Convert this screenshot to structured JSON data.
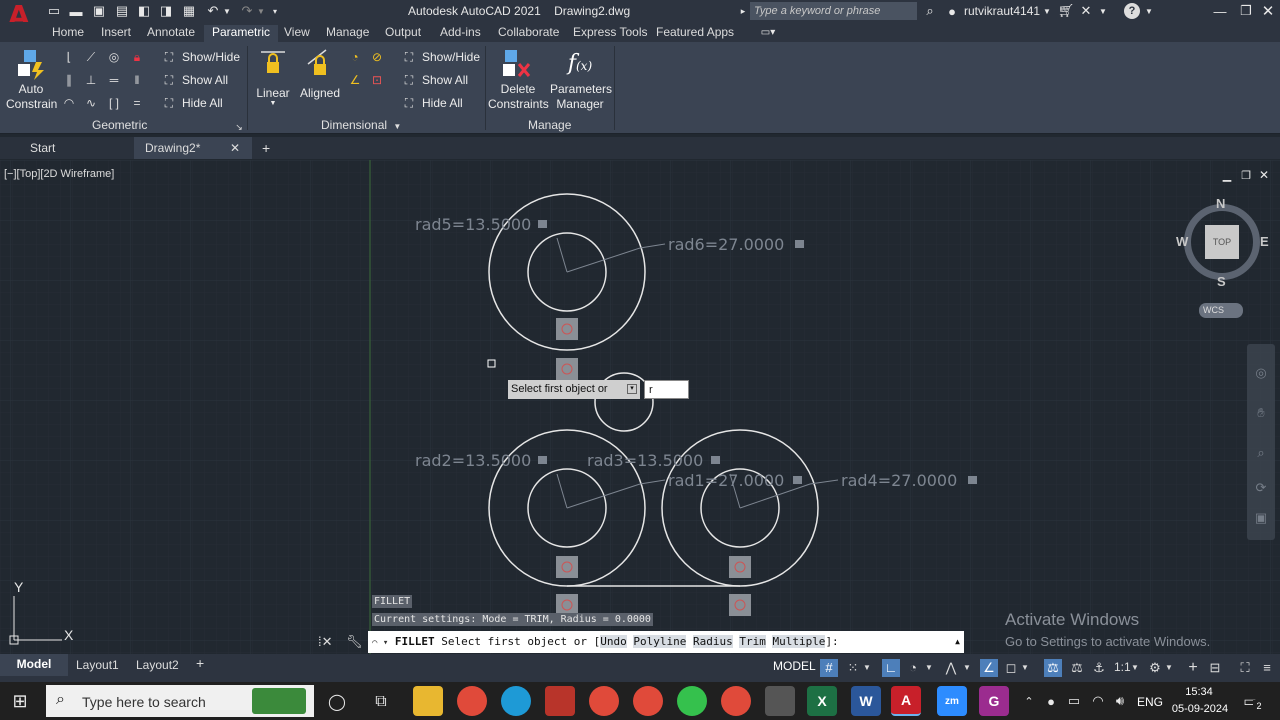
{
  "app": {
    "title": "Autodesk AutoCAD 2021",
    "file": "Drawing2.dwg",
    "search_placeholder": "Type a keyword or phrase",
    "user": "rutvikraut4141"
  },
  "ribbon_tabs": [
    "Home",
    "Insert",
    "Annotate",
    "Parametric",
    "View",
    "Manage",
    "Output",
    "Add-ins",
    "Collaborate",
    "Express Tools",
    "Featured Apps"
  ],
  "ribbon": {
    "auto_constrain": [
      "Auto",
      "Constrain"
    ],
    "geo_show_hide": "Show/Hide",
    "geo_show_all": "Show All",
    "geo_hide_all": "Hide All",
    "geometric_title": "Geometric",
    "linear": "Linear",
    "aligned": "Aligned",
    "dim_show_hide": "Show/Hide",
    "dim_show_all": "Show All",
    "dim_hide_all": "Hide All",
    "dimensional_title": "Dimensional",
    "delete_constraints": [
      "Delete",
      "Constraints"
    ],
    "parameters_manager": [
      "Parameters",
      "Manager"
    ],
    "manage_title": "Manage"
  },
  "doc_tabs": {
    "start": "Start",
    "drawing": "Drawing2*"
  },
  "viewport": {
    "label": "[−][Top][2D Wireframe]",
    "dims": {
      "rad5": "rad5=13.5000",
      "rad6": "rad6=27.0000",
      "rad2": "rad2=13.5000",
      "rad3": "rad3=13.5000",
      "rad1": "rad1=27.0000",
      "rad4": "rad4=27.0000"
    },
    "tooltip": "Select first object or",
    "tooltip_input": "r",
    "viewcube": {
      "n": "N",
      "s": "S",
      "e": "E",
      "w": "W",
      "top": "TOP",
      "wcs": "WCS"
    },
    "ucs_y": "Y",
    "ucs_x": "X"
  },
  "command": {
    "history1": "FILLET",
    "history2": "Current settings: Mode = TRIM, Radius = 0.0000",
    "prompt_cmd": "FILLET",
    "prompt_text": "Select first object or [",
    "options": [
      "Undo",
      "Polyline",
      "Radius",
      "Trim",
      "Multiple"
    ],
    "prompt_end": "]:"
  },
  "watermark": {
    "line1": "Activate Windows",
    "line2": "Go to Settings to activate Windows."
  },
  "layout_tabs": [
    "Model",
    "Layout1",
    "Layout2"
  ],
  "status": {
    "model": "MODEL",
    "scale": "1:1"
  },
  "taskbar": {
    "search_placeholder": "Type here to search",
    "lang": "ENG",
    "time": "15:34",
    "date": "05-09-2024",
    "notifications": "2"
  },
  "colors": {
    "accent_red": "#c8202a",
    "canvas": "#212830",
    "ribbon": "#3b4453"
  }
}
